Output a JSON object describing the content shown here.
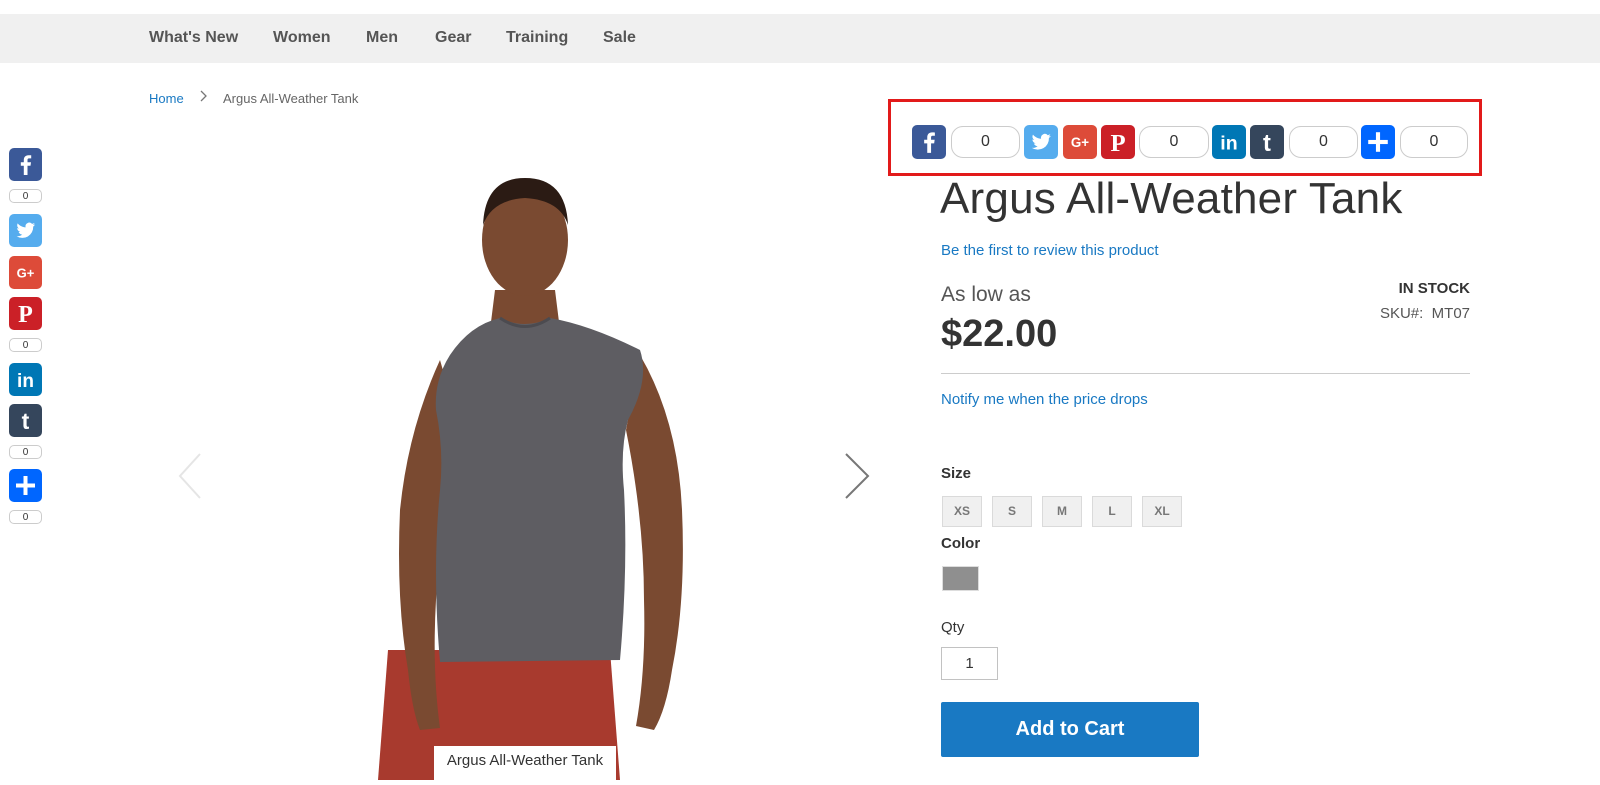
{
  "nav": {
    "items": [
      "What's New",
      "Women",
      "Men",
      "Gear",
      "Training",
      "Sale"
    ]
  },
  "breadcrumb": {
    "home": "Home",
    "current": "Argus All-Weather Tank"
  },
  "side_share": {
    "facebook_count": "0",
    "pinterest_count": "0",
    "tumblr_count": "0",
    "addthis_count": "0"
  },
  "share_bar": {
    "facebook_count": "0",
    "pinterest_count": "0",
    "tumblr_count": "0",
    "addthis_count": "0"
  },
  "gallery": {
    "caption": "Argus All-Weather Tank"
  },
  "product": {
    "title": "Argus All-Weather Tank",
    "review_link": "Be the first to review this product",
    "price_prefix": "As low as",
    "price": "$22.00",
    "stock": "IN STOCK",
    "sku_label": "SKU#:",
    "sku": "MT07",
    "notify_link": "Notify me when the price drops",
    "size_label": "Size",
    "sizes": [
      "XS",
      "S",
      "M",
      "L",
      "XL"
    ],
    "color_label": "Color",
    "color_swatch": "#8f8f8f",
    "qty_label": "Qty",
    "qty_value": "1",
    "add_to_cart": "Add to Cart"
  },
  "colors": {
    "link": "#1979c3",
    "button": "#1979c3",
    "highlight": "#e21a1a",
    "facebook": "#3b5998",
    "twitter": "#55acee",
    "google": "#dd4b39",
    "pinterest": "#cb2027",
    "linkedin": "#0077b5",
    "tumblr": "#35465c",
    "addthis": "#0066ff"
  },
  "icons": [
    "facebook-icon",
    "twitter-icon",
    "google-plus-icon",
    "pinterest-icon",
    "linkedin-icon",
    "tumblr-icon",
    "addthis-plus-icon",
    "chevron-right-icon",
    "chevron-left-icon"
  ]
}
